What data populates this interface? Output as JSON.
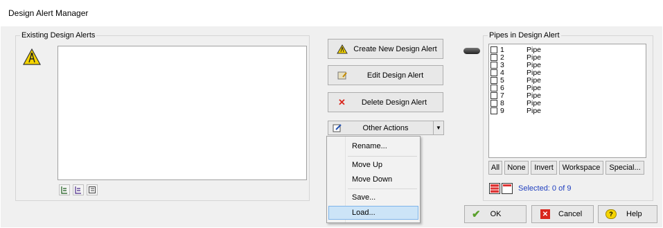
{
  "window": {
    "title": "Design Alert Manager"
  },
  "existing_alerts": {
    "label": "Existing Design Alerts",
    "items": []
  },
  "actions": {
    "create": "Create New Design Alert",
    "edit": "Edit Design Alert",
    "delete": "Delete Design Alert",
    "other": "Other Actions"
  },
  "menu": {
    "items": [
      "Rename...",
      "Move Up",
      "Move Down",
      "Save...",
      "Load..."
    ],
    "highlighted": "Load..."
  },
  "pipes": {
    "label": "Pipes in Design Alert",
    "rows": [
      {
        "id": "1",
        "type": "Pipe"
      },
      {
        "id": "2",
        "type": "Pipe"
      },
      {
        "id": "3",
        "type": "Pipe"
      },
      {
        "id": "4",
        "type": "Pipe"
      },
      {
        "id": "5",
        "type": "Pipe"
      },
      {
        "id": "6",
        "type": "Pipe"
      },
      {
        "id": "7",
        "type": "Pipe"
      },
      {
        "id": "8",
        "type": "Pipe"
      },
      {
        "id": "9",
        "type": "Pipe"
      }
    ],
    "buttons": {
      "all": "All",
      "none": "None",
      "invert": "Invert",
      "workspace": "Workspace",
      "special": "Special..."
    },
    "selected": "Selected: 0 of 9"
  },
  "dialog_buttons": {
    "ok": "OK",
    "cancel": "Cancel",
    "help": "Help"
  },
  "colors": {
    "highlight": "#cce4f7",
    "selected_text": "#1f3fbf",
    "warning": "#f5d400"
  }
}
